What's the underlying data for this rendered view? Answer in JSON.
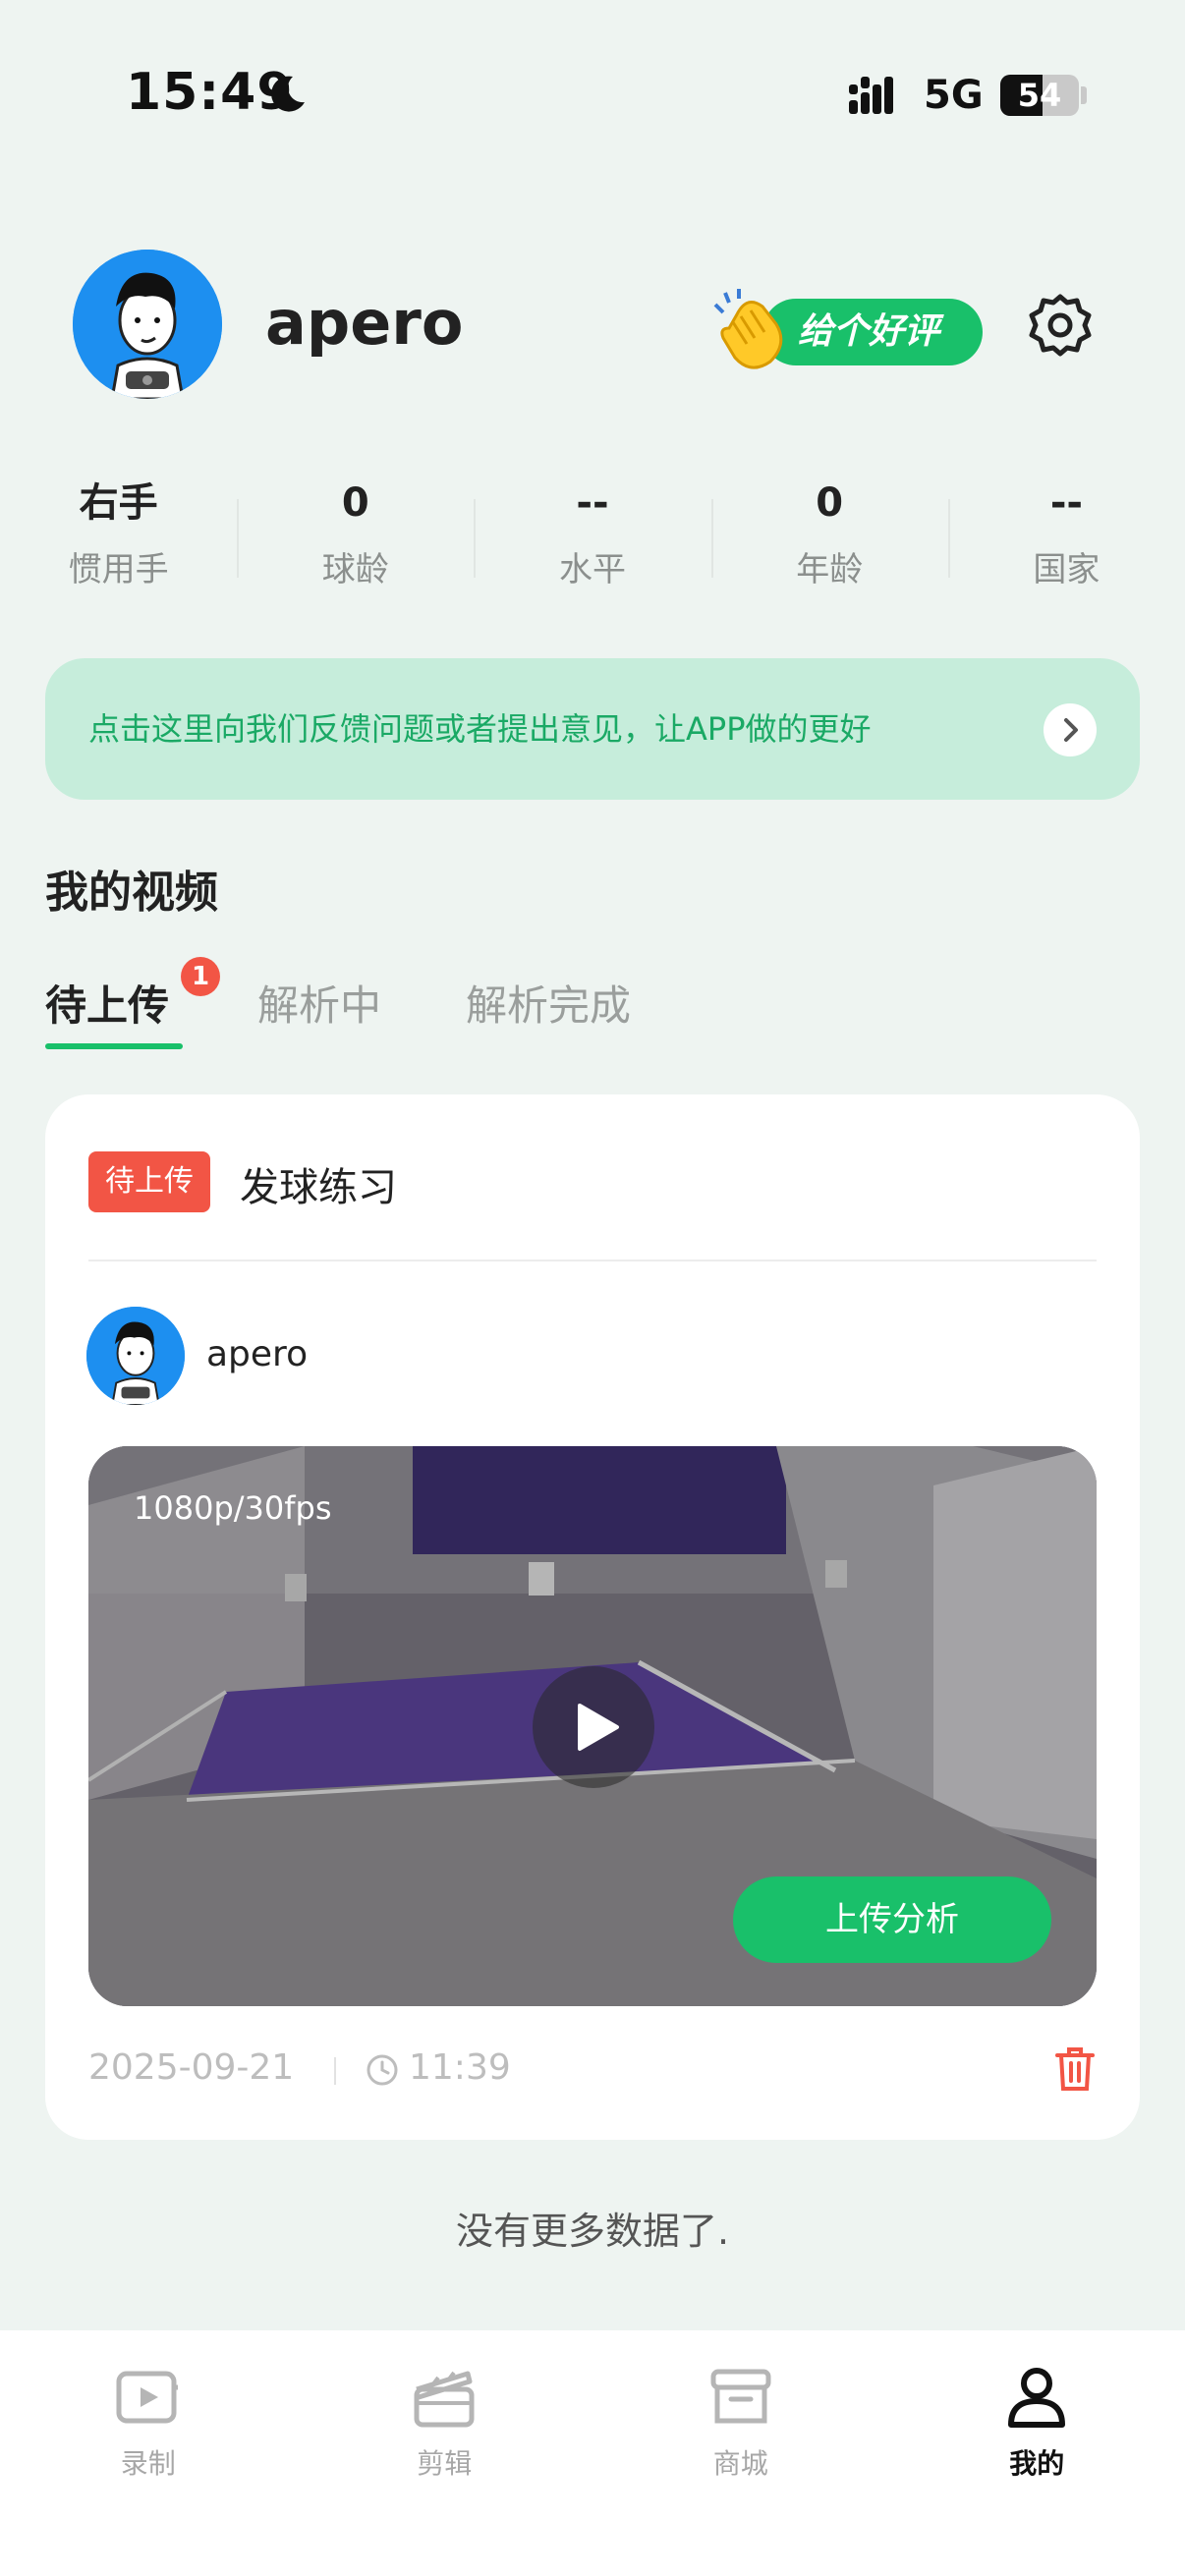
{
  "status_bar": {
    "time": "15:49",
    "network": "5G",
    "battery": "54",
    "battery_level": 0.54
  },
  "profile": {
    "username": "apero",
    "rate_label": "给个好评"
  },
  "stats": [
    {
      "value": "右手",
      "label": "惯用手"
    },
    {
      "value": "0",
      "label": "球龄"
    },
    {
      "value": "--",
      "label": "水平"
    },
    {
      "value": "0",
      "label": "年龄"
    },
    {
      "value": "--",
      "label": "国家"
    }
  ],
  "feedback": {
    "text": "点击这里向我们反馈问题或者提出意见，让APP做的更好"
  },
  "videos_section": {
    "title": "我的视频",
    "tabs": [
      {
        "label": "待上传",
        "badge": "1",
        "active": true
      },
      {
        "label": "解析中"
      },
      {
        "label": "解析完成"
      }
    ]
  },
  "video_card": {
    "tag": "待上传",
    "title": "发球练习",
    "author": "apero",
    "resolution": "1080p/30fps",
    "upload_label": "上传分析",
    "date": "2025-09-21",
    "time": "11:39"
  },
  "footer_note": "没有更多数据了.",
  "bottom_nav": [
    {
      "label": "录制",
      "icon": "record-icon"
    },
    {
      "label": "剪辑",
      "icon": "clapperboard-icon"
    },
    {
      "label": "商城",
      "icon": "store-icon"
    },
    {
      "label": "我的",
      "icon": "profile-icon",
      "active": true
    }
  ],
  "colors": {
    "accent": "#19c06a",
    "badge": "#f25545",
    "background": "#eef4f1"
  }
}
